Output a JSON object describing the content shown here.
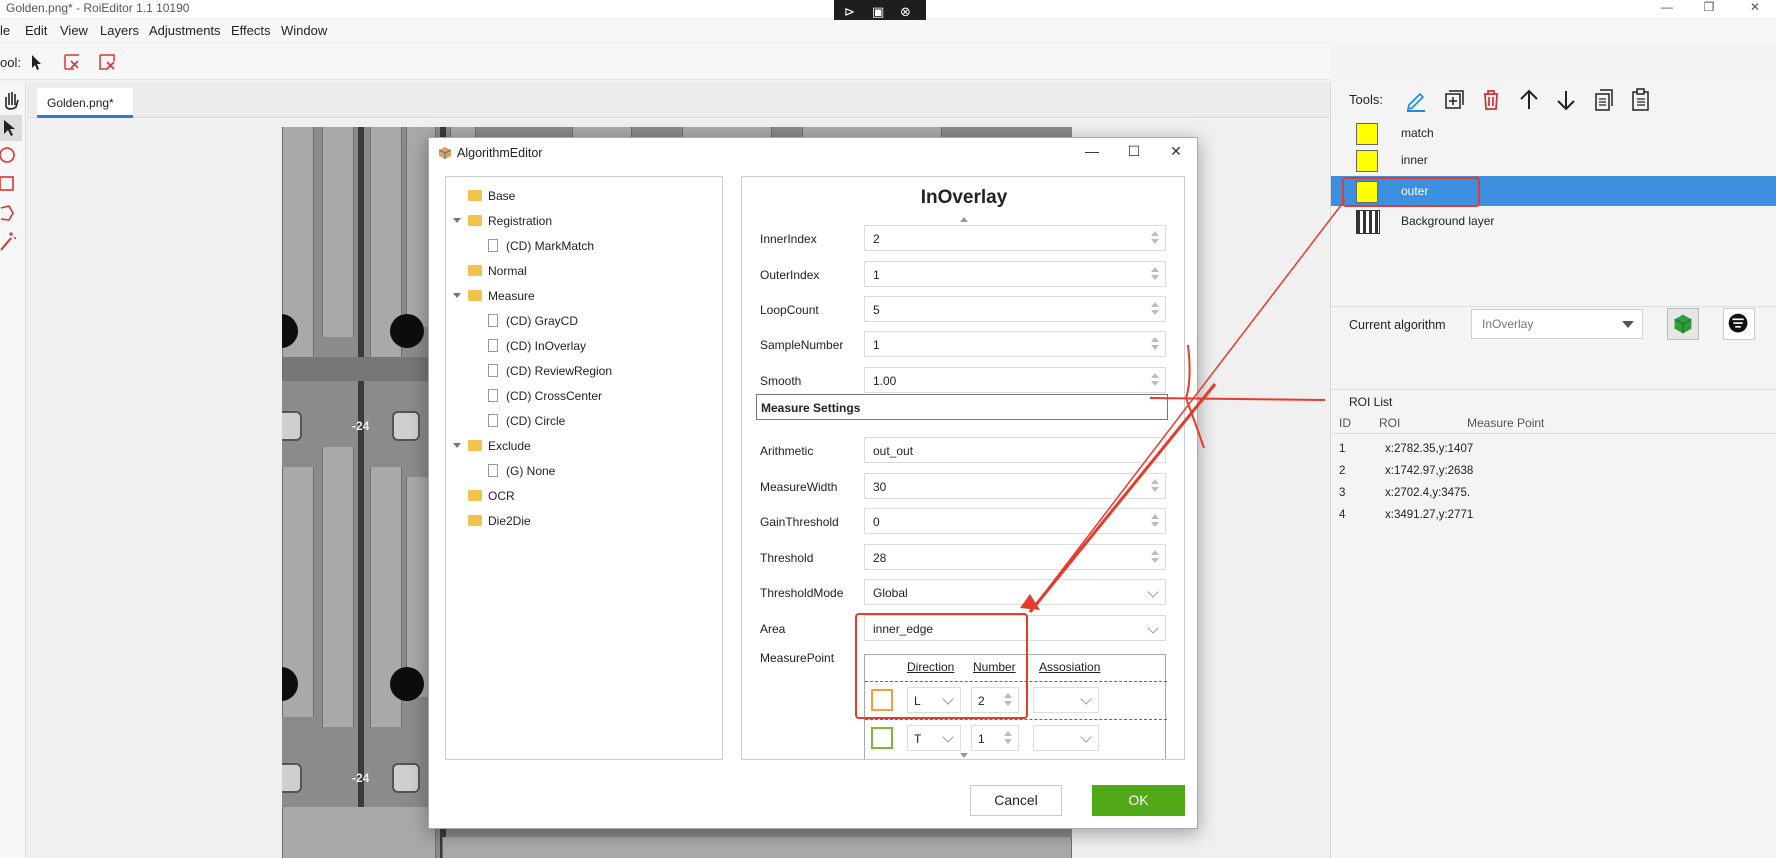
{
  "window": {
    "title": "Golden.png* - RoiEditor 1.1 10190",
    "minimize": "—",
    "maximize": "❐",
    "close": "✕"
  },
  "remote_bar": {
    "icons": [
      "pin-icon",
      "fit-screen-icon",
      "close-icon"
    ]
  },
  "menu": [
    "le",
    "Edit",
    "View",
    "Layers",
    "Adjustments",
    "Effects",
    "Window"
  ],
  "toolbar": {
    "label": "ool:"
  },
  "tab": {
    "label": "Golden.png*"
  },
  "canvas": {
    "overlay_text": "-24"
  },
  "right_panel": {
    "tools_label": "Tools:",
    "layers": [
      {
        "name": "match",
        "color": "#ffff00"
      },
      {
        "name": "inner",
        "color": "#ffff00"
      },
      {
        "name": "outer",
        "color": "#ffff00",
        "selected": true
      },
      {
        "name": "Background layer"
      }
    ],
    "current_algorithm_label": "Current algorithm",
    "current_algorithm_value": "InOverlay",
    "roi_list_title": "ROI List",
    "roi_columns": [
      "ID",
      "ROI",
      "Measure Point"
    ],
    "roi_rows": [
      {
        "id": "1",
        "roi": "x:2782.35,y:1407"
      },
      {
        "id": "2",
        "roi": "x:1742.97,y:2638"
      },
      {
        "id": "3",
        "roi": "x:2702.4,y:3475."
      },
      {
        "id": "4",
        "roi": "x:3491.27,y:2771"
      }
    ]
  },
  "dialog": {
    "title": "AlgorithmEditor",
    "minimize": "—",
    "maximize": "☐",
    "close": "✕",
    "tree": [
      {
        "label": "Base",
        "kind": "folder",
        "level": 0
      },
      {
        "label": "Registration",
        "kind": "folder",
        "level": 0,
        "expanded": true
      },
      {
        "label": "(CD) MarkMatch",
        "kind": "file",
        "level": 1
      },
      {
        "label": "Normal",
        "kind": "folder",
        "level": 0
      },
      {
        "label": "Measure",
        "kind": "folder",
        "level": 0,
        "expanded": true
      },
      {
        "label": "(CD) GrayCD",
        "kind": "file",
        "level": 1
      },
      {
        "label": "(CD) InOverlay",
        "kind": "file",
        "level": 1
      },
      {
        "label": "(CD) ReviewRegion",
        "kind": "file",
        "level": 1
      },
      {
        "label": "(CD) CrossCenter",
        "kind": "file",
        "level": 1
      },
      {
        "label": "(CD) Circle",
        "kind": "file",
        "level": 1
      },
      {
        "label": "Exclude",
        "kind": "folder",
        "level": 0,
        "expanded": true
      },
      {
        "label": "(G) None",
        "kind": "file",
        "level": 1
      },
      {
        "label": "OCR",
        "kind": "folder",
        "level": 0
      },
      {
        "label": "Die2Die",
        "kind": "folder",
        "level": 0
      }
    ],
    "props_title": "InOverlay",
    "props_top": [
      {
        "label": "InnerIndex",
        "value": "2",
        "control": "spin"
      },
      {
        "label": "OuterIndex",
        "value": "1",
        "control": "spin"
      },
      {
        "label": "LoopCount",
        "value": "5",
        "control": "spin"
      },
      {
        "label": "SampleNumber",
        "value": "1",
        "control": "spin"
      },
      {
        "label": "Smooth",
        "value": "1.00",
        "control": "spin"
      }
    ],
    "section_title": "Measure Settings",
    "props_bottom": [
      {
        "label": "Arithmetic",
        "value": "out_out",
        "control": "text"
      },
      {
        "label": "MeasureWidth",
        "value": "30",
        "control": "spin"
      },
      {
        "label": "GainThreshold",
        "value": "0",
        "control": "spin"
      },
      {
        "label": "Threshold",
        "value": "28",
        "control": "spin"
      },
      {
        "label": "ThresholdMode",
        "value": "Global",
        "control": "dropdown"
      },
      {
        "label": "Area",
        "value": "inner_edge",
        "control": "dropdown"
      }
    ],
    "measure_point_label": "MeasurePoint",
    "measure_point_columns": [
      "Direction",
      "Number",
      "Assosiation"
    ],
    "measure_points": [
      {
        "color": "#f0a040",
        "direction": "L",
        "number": "2",
        "association": ""
      },
      {
        "color": "#7ab83a",
        "direction": "T",
        "number": "1",
        "association": ""
      }
    ],
    "cancel_label": "Cancel",
    "ok_label": "OK"
  },
  "annotation_color": "#e53b2c"
}
